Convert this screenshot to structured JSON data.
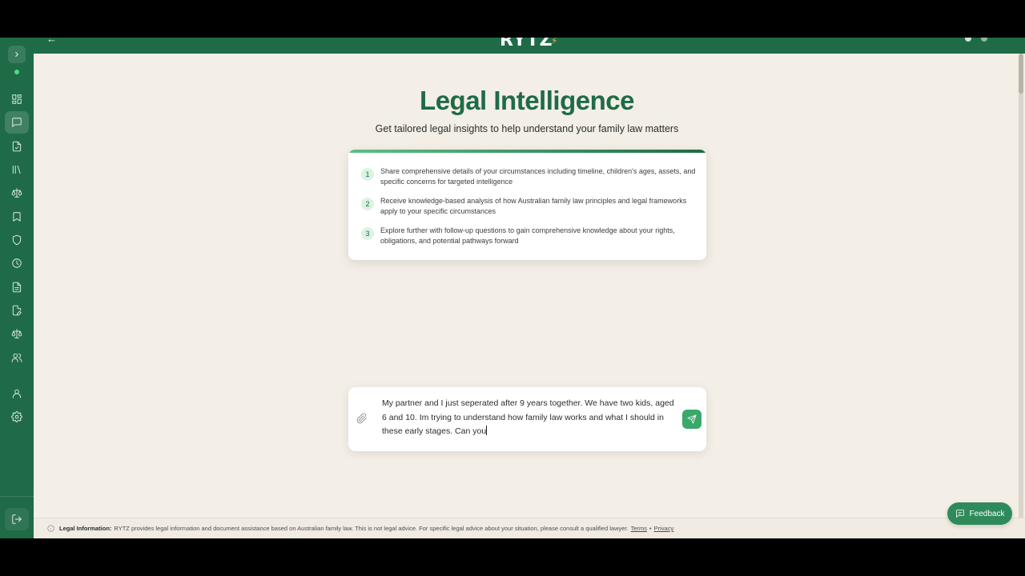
{
  "header": {
    "back_label": "←",
    "logo_text": "RYTZ",
    "logo_mark": "⚡"
  },
  "sidebar": {
    "expand_icon": "chevron-right-icon",
    "items": [
      {
        "name": "dashboard",
        "icon": "grid-icon",
        "active": false
      },
      {
        "name": "chat",
        "icon": "message-icon",
        "active": true
      },
      {
        "name": "documents",
        "icon": "file-icon",
        "active": false
      },
      {
        "name": "library",
        "icon": "library-icon",
        "active": false
      },
      {
        "name": "legal",
        "icon": "scale-icon",
        "active": false
      },
      {
        "name": "bookmarks",
        "icon": "bookmark-icon",
        "active": false
      },
      {
        "name": "security",
        "icon": "shield-icon",
        "active": false
      },
      {
        "name": "history",
        "icon": "clock-icon",
        "active": false
      },
      {
        "name": "notes",
        "icon": "document-icon",
        "active": false
      },
      {
        "name": "forms",
        "icon": "file-edit-icon",
        "active": false
      },
      {
        "name": "court",
        "icon": "scale-icon",
        "active": false
      },
      {
        "name": "people",
        "icon": "users-icon",
        "active": false
      },
      {
        "name": "profile",
        "icon": "user-icon",
        "active": false
      },
      {
        "name": "settings",
        "icon": "gear-icon",
        "active": false
      }
    ],
    "logout_icon": "logout-icon"
  },
  "main": {
    "title": "Legal Intelligence",
    "subtitle": "Get tailored legal insights to help understand your family law matters",
    "steps": [
      {
        "number": "1",
        "text": "Share comprehensive details of your circumstances including timeline, children's ages, assets, and specific concerns for targeted intelligence"
      },
      {
        "number": "2",
        "text": "Receive knowledge-based analysis of how Australian family law principles and legal frameworks apply to your specific circumstances"
      },
      {
        "number": "3",
        "text": "Explore further with follow-up questions to gain comprehensive knowledge about your rights, obligations, and potential pathways forward"
      }
    ]
  },
  "composer": {
    "message": "My partner and I just seperated after 9 years together. We have two kids, aged 6 and 10. Im trying to understand how family law works and what I should in these early stages. Can you"
  },
  "feedback": {
    "label": "Feedback"
  },
  "footer": {
    "label": "Legal Information:",
    "text": "RYTZ provides legal information and document assistance based on Australian family law. This is not legal advice. For specific legal advice about your situation, please consult a qualified lawyer.",
    "terms": "Terms",
    "separator": "•",
    "privacy": "Privacy"
  },
  "colors": {
    "brand_green": "#1f6b47",
    "accent_green": "#3aa86a",
    "background": "#f3eee6"
  }
}
